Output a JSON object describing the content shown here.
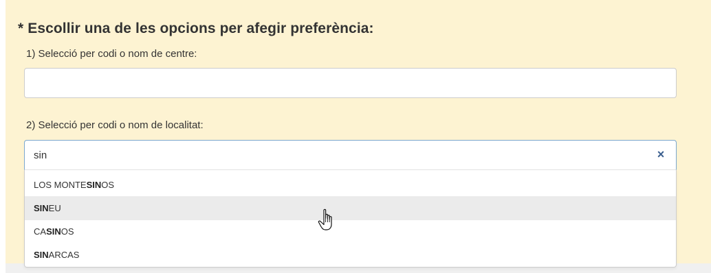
{
  "form": {
    "title": "* Escollir una de les opcions per afegir preferència:",
    "centre_label": "1) Selecció per codi o nom de centre:",
    "centre_value": "",
    "localitat_label": "2) Selecció per codi o nom de localitat:",
    "localitat_value": "sin",
    "clear_symbol": "×"
  },
  "suggestions": [
    {
      "pre": "LOS MONTE",
      "match": "SIN",
      "post": "OS",
      "highlighted": false
    },
    {
      "pre": "",
      "match": "SIN",
      "post": "EU",
      "highlighted": true
    },
    {
      "pre": "CA",
      "match": "SIN",
      "post": "OS",
      "highlighted": false
    },
    {
      "pre": "",
      "match": "SIN",
      "post": "ARCAS",
      "highlighted": false
    }
  ],
  "colors": {
    "panel_bg": "#fdf3d2",
    "highlight_bg": "#ebebeb",
    "clear_icon": "#3b5f8f"
  },
  "icons": {
    "cursor": "hand-pointer-icon",
    "clear": "close-icon"
  }
}
